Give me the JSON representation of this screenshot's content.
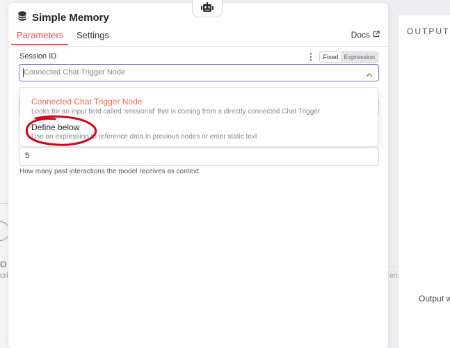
{
  "panel": {
    "title": "Simple Memory",
    "title_icon": "database-icon",
    "node_icon": "robot-icon"
  },
  "tabs": {
    "parameters": "Parameters",
    "settings": "Settings",
    "active": "Parameters"
  },
  "docs": {
    "label": "Docs",
    "icon": "external-link-icon"
  },
  "session_id": {
    "label": "Session ID",
    "toggle_fixed": "Fixed",
    "toggle_expression": "Expression",
    "selected": "Connected Chat Trigger Node"
  },
  "dropdown": {
    "options": [
      {
        "title": "Connected Chat Trigger Node",
        "description": "Looks for an input field called 'sessionId' that is coming from a directly connected Chat Trigger"
      },
      {
        "title": "Define below",
        "description": "Use an expression to reference data in previous nodes or enter static text"
      }
    ]
  },
  "context_window": {
    "value": "5",
    "hint": "How many past interactions the model receives as context"
  },
  "output": {
    "title": "OUTPUT",
    "message": "Output w"
  },
  "background": {
    "frag_a": "O",
    "frag_b": "cri",
    "frag_right": "em"
  },
  "colors": {
    "accent": "#ea4b4b",
    "focus": "#7b6cc9",
    "annotation": "#d0021b"
  }
}
